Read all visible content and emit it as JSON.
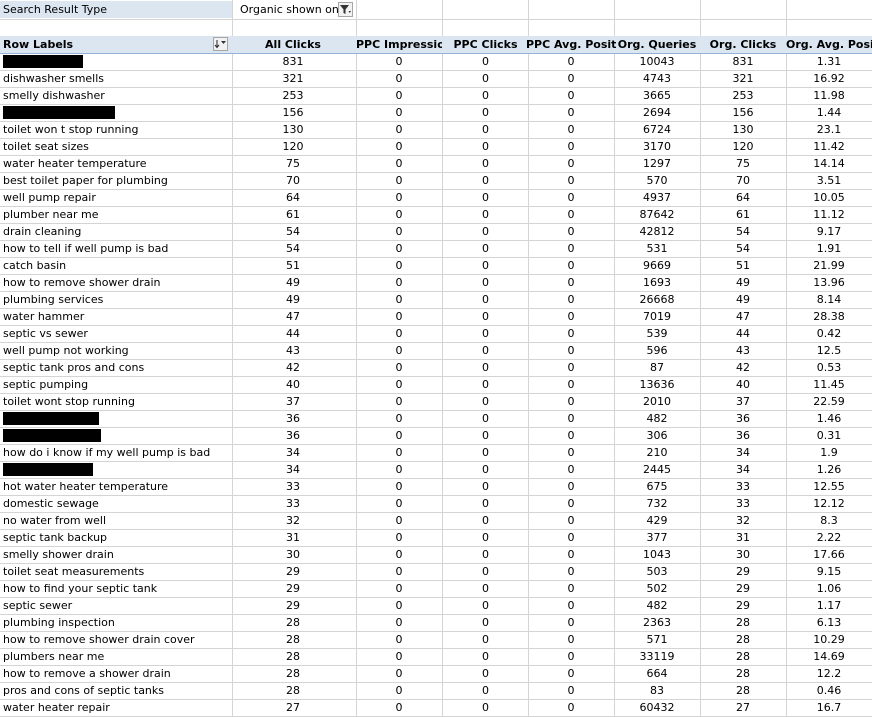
{
  "filter": {
    "label": "Search Result Type",
    "value": "Organic shown on",
    "icon": "filter-icon"
  },
  "headers": {
    "row_labels": "Row Labels",
    "all_clicks": "All Clicks",
    "ppc_impressions": "PPC Impressions",
    "ppc_clicks": "PPC Clicks",
    "ppc_avg_position": "PPC Avg. Position",
    "org_queries": "Org. Queries",
    "org_clicks": "Org. Clicks",
    "org_avg_position": "Org. Avg. Position",
    "sort_icon": "sort-descending-icon"
  },
  "rows": [
    {
      "label": "",
      "redacted": true,
      "all": "831",
      "ppci": "0",
      "ppcc": "0",
      "ppcp": "0",
      "oq": "10043",
      "oc": "831",
      "op": "1.31"
    },
    {
      "label": "dishwasher smells",
      "all": "321",
      "ppci": "0",
      "ppcc": "0",
      "ppcp": "0",
      "oq": "4743",
      "oc": "321",
      "op": "16.92"
    },
    {
      "label": "smelly dishwasher",
      "all": "253",
      "ppci": "0",
      "ppcc": "0",
      "ppcp": "0",
      "oq": "3665",
      "oc": "253",
      "op": "11.98"
    },
    {
      "label": "",
      "redacted": true,
      "all": "156",
      "ppci": "0",
      "ppcc": "0",
      "ppcp": "0",
      "oq": "2694",
      "oc": "156",
      "op": "1.44"
    },
    {
      "label": "toilet won t stop running",
      "all": "130",
      "ppci": "0",
      "ppcc": "0",
      "ppcp": "0",
      "oq": "6724",
      "oc": "130",
      "op": "23.1"
    },
    {
      "label": "toilet seat sizes",
      "all": "120",
      "ppci": "0",
      "ppcc": "0",
      "ppcp": "0",
      "oq": "3170",
      "oc": "120",
      "op": "11.42"
    },
    {
      "label": "water heater temperature",
      "all": "75",
      "ppci": "0",
      "ppcc": "0",
      "ppcp": "0",
      "oq": "1297",
      "oc": "75",
      "op": "14.14"
    },
    {
      "label": "best toilet paper for plumbing",
      "all": "70",
      "ppci": "0",
      "ppcc": "0",
      "ppcp": "0",
      "oq": "570",
      "oc": "70",
      "op": "3.51"
    },
    {
      "label": "well pump repair",
      "all": "64",
      "ppci": "0",
      "ppcc": "0",
      "ppcp": "0",
      "oq": "4937",
      "oc": "64",
      "op": "10.05"
    },
    {
      "label": "plumber near me",
      "all": "61",
      "ppci": "0",
      "ppcc": "0",
      "ppcp": "0",
      "oq": "87642",
      "oc": "61",
      "op": "11.12"
    },
    {
      "label": "drain cleaning",
      "all": "54",
      "ppci": "0",
      "ppcc": "0",
      "ppcp": "0",
      "oq": "42812",
      "oc": "54",
      "op": "9.17"
    },
    {
      "label": "how to tell if well pump is bad",
      "all": "54",
      "ppci": "0",
      "ppcc": "0",
      "ppcp": "0",
      "oq": "531",
      "oc": "54",
      "op": "1.91"
    },
    {
      "label": "catch basin",
      "all": "51",
      "ppci": "0",
      "ppcc": "0",
      "ppcp": "0",
      "oq": "9669",
      "oc": "51",
      "op": "21.99"
    },
    {
      "label": "how to remove shower drain",
      "all": "49",
      "ppci": "0",
      "ppcc": "0",
      "ppcp": "0",
      "oq": "1693",
      "oc": "49",
      "op": "13.96"
    },
    {
      "label": "plumbing services",
      "all": "49",
      "ppci": "0",
      "ppcc": "0",
      "ppcp": "0",
      "oq": "26668",
      "oc": "49",
      "op": "8.14"
    },
    {
      "label": "water hammer",
      "all": "47",
      "ppci": "0",
      "ppcc": "0",
      "ppcp": "0",
      "oq": "7019",
      "oc": "47",
      "op": "28.38"
    },
    {
      "label": "septic vs sewer",
      "all": "44",
      "ppci": "0",
      "ppcc": "0",
      "ppcp": "0",
      "oq": "539",
      "oc": "44",
      "op": "0.42"
    },
    {
      "label": "well pump not working",
      "all": "43",
      "ppci": "0",
      "ppcc": "0",
      "ppcp": "0",
      "oq": "596",
      "oc": "43",
      "op": "12.5"
    },
    {
      "label": "septic tank pros and cons",
      "all": "42",
      "ppci": "0",
      "ppcc": "0",
      "ppcp": "0",
      "oq": "87",
      "oc": "42",
      "op": "0.53"
    },
    {
      "label": "septic pumping",
      "all": "40",
      "ppci": "0",
      "ppcc": "0",
      "ppcp": "0",
      "oq": "13636",
      "oc": "40",
      "op": "11.45"
    },
    {
      "label": "toilet wont stop running",
      "all": "37",
      "ppci": "0",
      "ppcc": "0",
      "ppcp": "0",
      "oq": "2010",
      "oc": "37",
      "op": "22.59"
    },
    {
      "label": "",
      "redacted": true,
      "all": "36",
      "ppci": "0",
      "ppcc": "0",
      "ppcp": "0",
      "oq": "482",
      "oc": "36",
      "op": "1.46"
    },
    {
      "label": "",
      "redacted": true,
      "all": "36",
      "ppci": "0",
      "ppcc": "0",
      "ppcp": "0",
      "oq": "306",
      "oc": "36",
      "op": "0.31"
    },
    {
      "label": "how do i know if my well pump is bad",
      "all": "34",
      "ppci": "0",
      "ppcc": "0",
      "ppcp": "0",
      "oq": "210",
      "oc": "34",
      "op": "1.9"
    },
    {
      "label": "",
      "redacted": true,
      "all": "34",
      "ppci": "0",
      "ppcc": "0",
      "ppcp": "0",
      "oq": "2445",
      "oc": "34",
      "op": "1.26"
    },
    {
      "label": "hot water heater temperature",
      "all": "33",
      "ppci": "0",
      "ppcc": "0",
      "ppcp": "0",
      "oq": "675",
      "oc": "33",
      "op": "12.55"
    },
    {
      "label": "domestic sewage",
      "all": "33",
      "ppci": "0",
      "ppcc": "0",
      "ppcp": "0",
      "oq": "732",
      "oc": "33",
      "op": "12.12"
    },
    {
      "label": "no water from well",
      "all": "32",
      "ppci": "0",
      "ppcc": "0",
      "ppcp": "0",
      "oq": "429",
      "oc": "32",
      "op": "8.3"
    },
    {
      "label": "septic tank backup",
      "all": "31",
      "ppci": "0",
      "ppcc": "0",
      "ppcp": "0",
      "oq": "377",
      "oc": "31",
      "op": "2.22"
    },
    {
      "label": "smelly shower drain",
      "all": "30",
      "ppci": "0",
      "ppcc": "0",
      "ppcp": "0",
      "oq": "1043",
      "oc": "30",
      "op": "17.66"
    },
    {
      "label": "toilet seat measurements",
      "all": "29",
      "ppci": "0",
      "ppcc": "0",
      "ppcp": "0",
      "oq": "503",
      "oc": "29",
      "op": "9.15"
    },
    {
      "label": "how to find your septic tank",
      "all": "29",
      "ppci": "0",
      "ppcc": "0",
      "ppcp": "0",
      "oq": "502",
      "oc": "29",
      "op": "1.06"
    },
    {
      "label": "septic sewer",
      "all": "29",
      "ppci": "0",
      "ppcc": "0",
      "ppcp": "0",
      "oq": "482",
      "oc": "29",
      "op": "1.17"
    },
    {
      "label": "plumbing inspection",
      "all": "28",
      "ppci": "0",
      "ppcc": "0",
      "ppcp": "0",
      "oq": "2363",
      "oc": "28",
      "op": "6.13"
    },
    {
      "label": "how to remove shower drain cover",
      "all": "28",
      "ppci": "0",
      "ppcc": "0",
      "ppcp": "0",
      "oq": "571",
      "oc": "28",
      "op": "10.29"
    },
    {
      "label": "plumbers near me",
      "all": "28",
      "ppci": "0",
      "ppcc": "0",
      "ppcp": "0",
      "oq": "33119",
      "oc": "28",
      "op": "14.69"
    },
    {
      "label": "how to remove a shower drain",
      "all": "28",
      "ppci": "0",
      "ppcc": "0",
      "ppcp": "0",
      "oq": "664",
      "oc": "28",
      "op": "12.2"
    },
    {
      "label": "pros and cons of septic tanks",
      "all": "28",
      "ppci": "0",
      "ppcc": "0",
      "ppcp": "0",
      "oq": "83",
      "oc": "28",
      "op": "0.46"
    },
    {
      "label": "water heater repair",
      "all": "27",
      "ppci": "0",
      "ppcc": "0",
      "ppcp": "0",
      "oq": "60432",
      "oc": "27",
      "op": "16.7"
    }
  ]
}
